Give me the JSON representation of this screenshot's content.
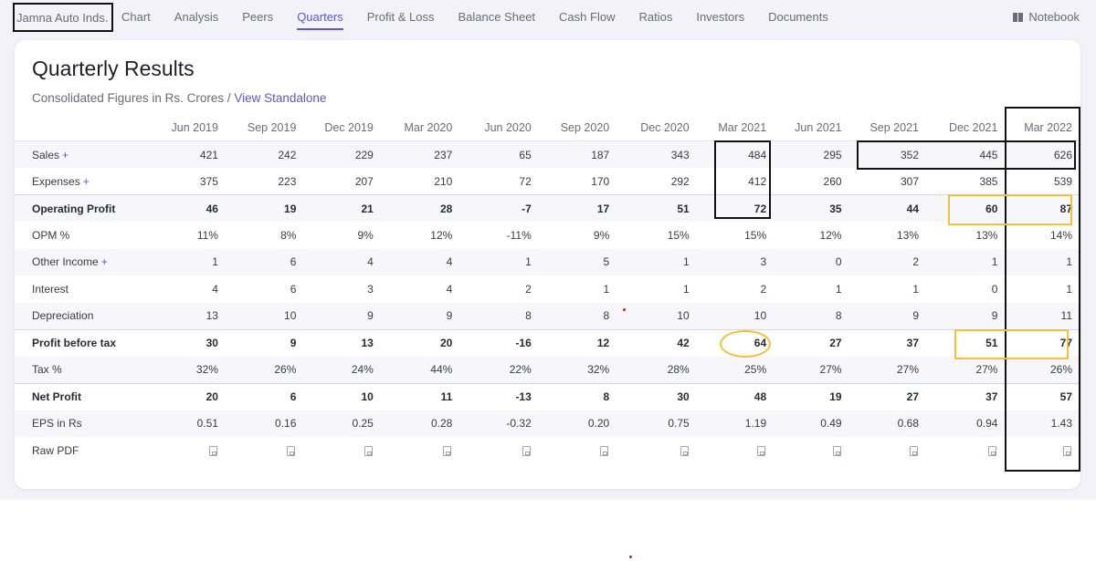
{
  "nav": {
    "company": "Jamna Auto Inds.",
    "tabs": [
      {
        "label": "Chart"
      },
      {
        "label": "Analysis"
      },
      {
        "label": "Peers"
      },
      {
        "label": "Quarters",
        "active": true
      },
      {
        "label": "Profit & Loss"
      },
      {
        "label": "Balance Sheet"
      },
      {
        "label": "Cash Flow"
      },
      {
        "label": "Ratios"
      },
      {
        "label": "Investors"
      },
      {
        "label": "Documents"
      }
    ],
    "notebook_label": "Notebook",
    "notebook_icon": "book-icon"
  },
  "card": {
    "title": "Quarterly Results",
    "subtitle_prefix": "Consolidated Figures in Rs. Crores / ",
    "subtitle_link": "View Standalone"
  },
  "table": {
    "columns": [
      "Jun 2019",
      "Sep 2019",
      "Dec 2019",
      "Mar 2020",
      "Jun 2020",
      "Sep 2020",
      "Dec 2020",
      "Mar 2021",
      "Jun 2021",
      "Sep 2021",
      "Dec 2021",
      "Mar 2022"
    ],
    "expand_symbol": "+",
    "rows": [
      {
        "label": "Sales",
        "expandable": true,
        "shaded": true,
        "bold": false,
        "values": [
          "421",
          "242",
          "229",
          "237",
          "65",
          "187",
          "343",
          "484",
          "295",
          "352",
          "445",
          "626"
        ]
      },
      {
        "label": "Expenses",
        "expandable": true,
        "shaded": false,
        "bold": false,
        "values": [
          "375",
          "223",
          "207",
          "210",
          "72",
          "170",
          "292",
          "412",
          "260",
          "307",
          "385",
          "539"
        ]
      },
      {
        "label": "Operating Profit",
        "expandable": false,
        "shaded": true,
        "bold": true,
        "topline": true,
        "values": [
          "46",
          "19",
          "21",
          "28",
          "-7",
          "17",
          "51",
          "72",
          "35",
          "44",
          "60",
          "87"
        ]
      },
      {
        "label": "OPM %",
        "expandable": false,
        "shaded": false,
        "bold": false,
        "values": [
          "11%",
          "8%",
          "9%",
          "12%",
          "-11%",
          "9%",
          "15%",
          "15%",
          "12%",
          "13%",
          "13%",
          "14%"
        ]
      },
      {
        "label": "Other Income",
        "expandable": true,
        "shaded": true,
        "bold": false,
        "values": [
          "1",
          "6",
          "4",
          "4",
          "1",
          "5",
          "1",
          "3",
          "0",
          "2",
          "1",
          "1"
        ]
      },
      {
        "label": "Interest",
        "expandable": false,
        "shaded": false,
        "bold": false,
        "values": [
          "4",
          "6",
          "3",
          "4",
          "2",
          "1",
          "1",
          "2",
          "1",
          "1",
          "0",
          "1"
        ]
      },
      {
        "label": "Depreciation",
        "expandable": false,
        "shaded": true,
        "bold": false,
        "values": [
          "13",
          "10",
          "9",
          "9",
          "8",
          "8",
          "10",
          "10",
          "8",
          "9",
          "9",
          "11"
        ]
      },
      {
        "label": "Profit before tax",
        "expandable": false,
        "shaded": false,
        "bold": true,
        "topline": true,
        "values": [
          "30",
          "9",
          "13",
          "20",
          "-16",
          "12",
          "42",
          "64",
          "27",
          "37",
          "51",
          "77"
        ]
      },
      {
        "label": "Tax %",
        "expandable": false,
        "shaded": true,
        "bold": false,
        "values": [
          "32%",
          "26%",
          "24%",
          "44%",
          "22%",
          "32%",
          "28%",
          "25%",
          "27%",
          "27%",
          "27%",
          "26%"
        ]
      },
      {
        "label": "Net Profit",
        "expandable": false,
        "shaded": false,
        "bold": true,
        "topline": true,
        "values": [
          "20",
          "6",
          "10",
          "11",
          "-13",
          "8",
          "30",
          "48",
          "19",
          "27",
          "37",
          "57"
        ]
      },
      {
        "label": "EPS in Rs",
        "expandable": false,
        "shaded": true,
        "bold": false,
        "values": [
          "0.51",
          "0.16",
          "0.25",
          "0.28",
          "-0.32",
          "0.20",
          "0.75",
          "1.19",
          "0.49",
          "0.68",
          "0.94",
          "1.43"
        ]
      }
    ],
    "rawpdf_label": "Raw PDF",
    "rawpdf_icon": "pdf-icon"
  },
  "annotation_colors": {
    "black": "#111111",
    "yellow": "#f2c234",
    "red": "#d32020"
  }
}
